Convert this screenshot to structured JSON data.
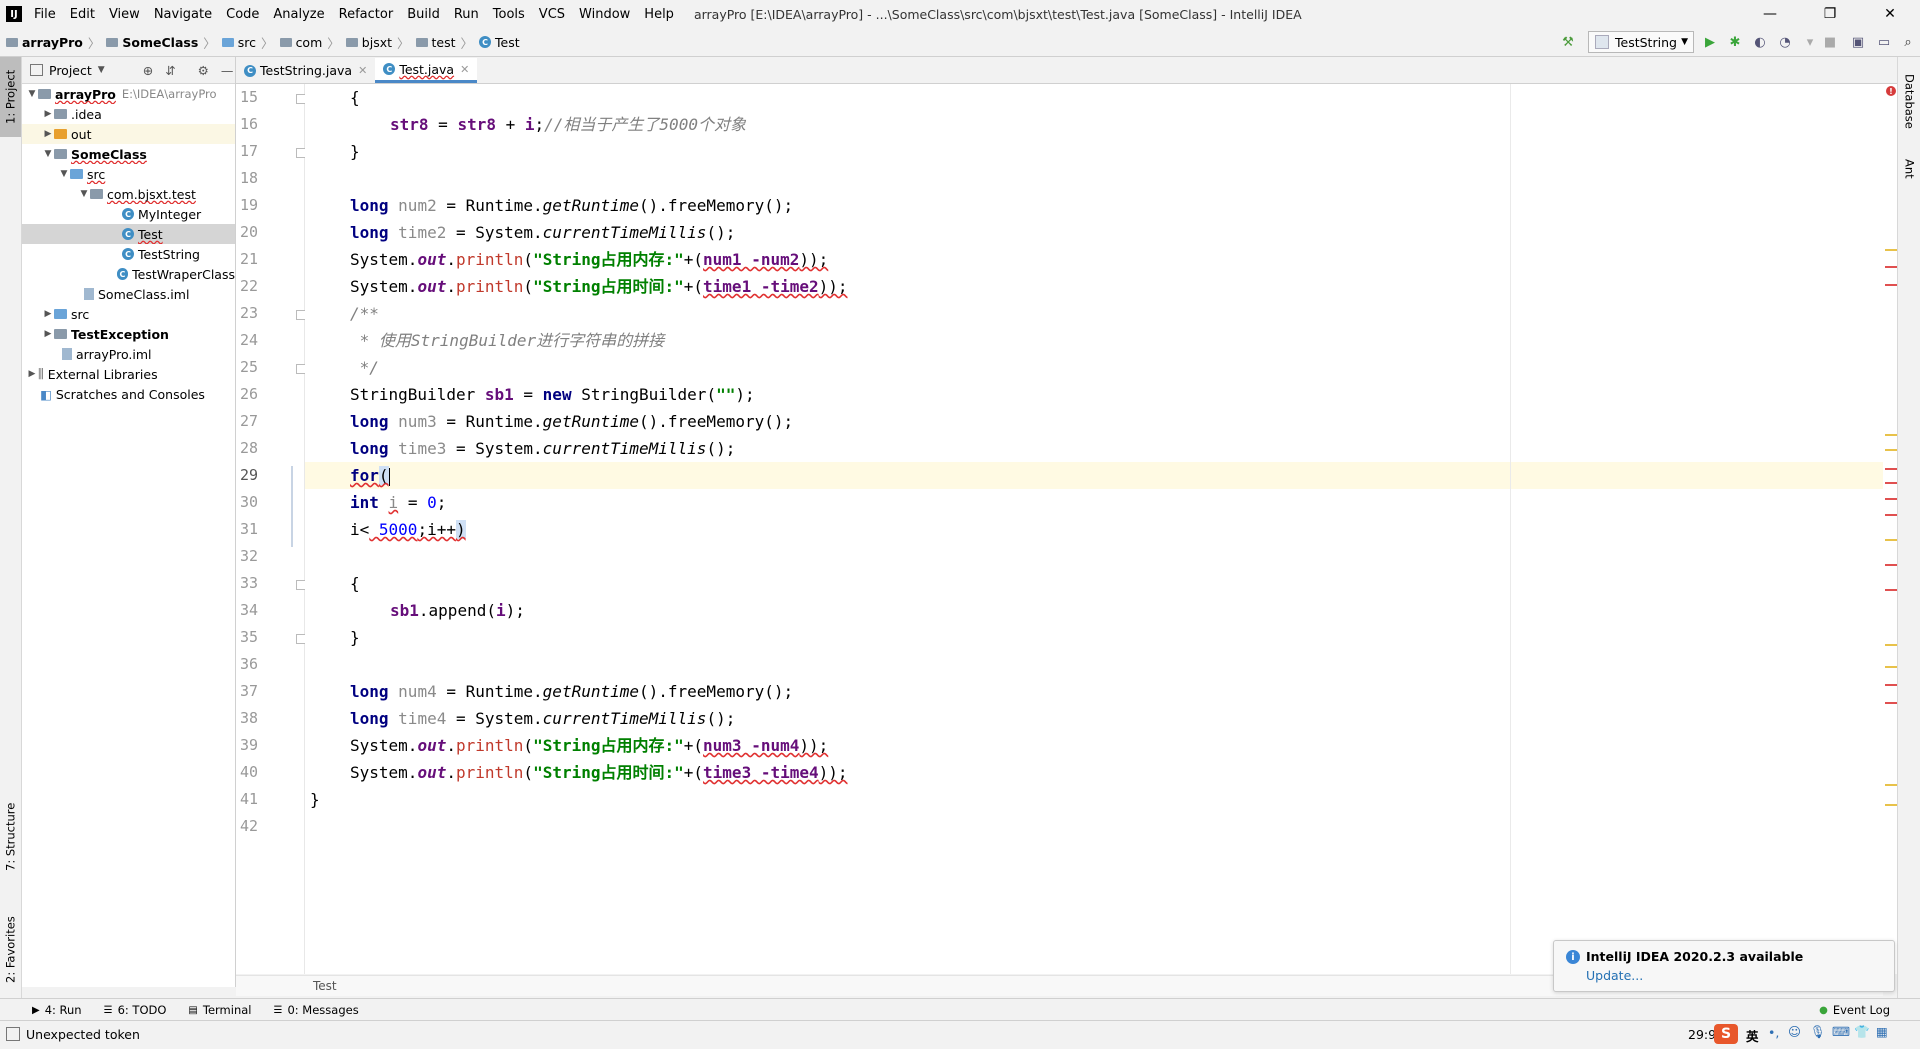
{
  "menubar": {
    "logo": "IJ",
    "items": [
      "File",
      "Edit",
      "View",
      "Navigate",
      "Code",
      "Analyze",
      "Refactor",
      "Build",
      "Run",
      "Tools",
      "VCS",
      "Window",
      "Help"
    ],
    "title": "arrayPro [E:\\IDEA\\arrayPro] - ...\\SomeClass\\src\\com\\bjsxt\\test\\Test.java [SomeClass] - IntelliJ IDEA",
    "controls": [
      "—",
      "❐",
      "✕"
    ]
  },
  "navbar": {
    "crumbs": [
      "arrayPro",
      "SomeClass",
      "src",
      "com",
      "bjsxt",
      "test",
      "Test"
    ],
    "run_config": "TestString"
  },
  "left_stripe": {
    "project": "1: Project",
    "structure": "7: Structure",
    "favorites": "2: Favorites"
  },
  "right_stripe": {
    "database": "Database",
    "ant": "Ant"
  },
  "project": {
    "header": "Project",
    "tree": [
      {
        "label": "arrayPro",
        "extra": "E:\\IDEA\\arrayPro"
      },
      {
        "label": ".idea"
      },
      {
        "label": "out"
      },
      {
        "label": "SomeClass"
      },
      {
        "label": "src"
      },
      {
        "label": "com.bjsxt.test"
      },
      {
        "label": "MyInteger"
      },
      {
        "label": "Test"
      },
      {
        "label": "TestString"
      },
      {
        "label": "TestWraperClass"
      },
      {
        "label": "SomeClass.iml"
      },
      {
        "label": "src"
      },
      {
        "label": "TestException"
      },
      {
        "label": "arrayPro.iml"
      },
      {
        "label": "External Libraries"
      },
      {
        "label": "Scratches and Consoles"
      }
    ]
  },
  "tabs": [
    {
      "label": "TestString.java"
    },
    {
      "label": "Test.java"
    }
  ],
  "editor": {
    "line_numbers": [
      "15",
      "16",
      "17",
      "18",
      "19",
      "20",
      "21",
      "22",
      "23",
      "24",
      "25",
      "26",
      "27",
      "28",
      "29",
      "30",
      "31",
      "32",
      "33",
      "34",
      "35",
      "36",
      "37",
      "38",
      "39",
      "40",
      "41",
      "42"
    ],
    "code": {
      "l15": "{",
      "l16_a": "str8",
      "l16_b": " = ",
      "l16_c": "str8",
      "l16_d": " + ",
      "l16_e": "i",
      "l16_f": ";",
      "l16_cmt": "//相当于产生了5000个对象",
      "l17": "}",
      "long": "long",
      "int": "int",
      "new": "new",
      "for": "for",
      "num2": "num2",
      "time2": "time2",
      "num3": "num3",
      "time3": "time3",
      "num4": "num4",
      "time4": "time4",
      "runtime_a": " = Runtime.",
      "getRuntime": "getRuntime",
      "free": "().freeMemory();",
      "system_a": " = System.",
      "ctm": "currentTimeMillis",
      "ctm_end": "();",
      "sys": "System.",
      "out": "out",
      "dot": ".",
      "println": "println",
      "lp": "(",
      "s_mem": "\"String占用内存:\"",
      "s_time": "\"String占用时间:\"",
      "plus_lp": "+(",
      "num1_num2": "num1 -num2",
      "time1_time2": "time1 -time2",
      "num3_num4": "num3 -num4",
      "time3_time4": "time3 -time4",
      "rpr": "));",
      "c23": "/**",
      "c24": " * 使用StringBuilder进行字符串的拼接",
      "c25": " */",
      "sb_type": "StringBuilder ",
      "sb1": "sb1",
      "sb_eq": " = ",
      "sb_ctor": " StringBuilder(",
      "sb_str": "\"\"",
      "sb_end": ");",
      "for_paren": "(",
      "i_var": "i",
      "eq0": " = ",
      "zero": "0",
      "semi": ";",
      "l31_a": "i<",
      "l31_b": " 5000",
      "l31_c": ";i++",
      "l31_d": ")",
      "l33": "{",
      "l34_a": "sb1",
      "l34_b": ".append(",
      "l34_c": "i",
      "l34_d": ");",
      "l35": "}",
      "l41": "}"
    }
  },
  "editor_breadcrumb": "Test",
  "bottom_tools": [
    "4: Run",
    "6: TODO",
    "Terminal",
    "0: Messages"
  ],
  "event_log": "Event Log",
  "status": {
    "message": "Unexpected token",
    "position": "29:9",
    "ime": "英"
  },
  "notification": {
    "title": "IntelliJ IDEA 2020.2.3 available",
    "link": "Update..."
  },
  "colors": {
    "accent": "#4a88c7",
    "keyword": "#000080",
    "string": "#008000",
    "number": "#0000ff",
    "comment": "#808080",
    "error": "#e03030",
    "current_line": "#fffae3"
  }
}
